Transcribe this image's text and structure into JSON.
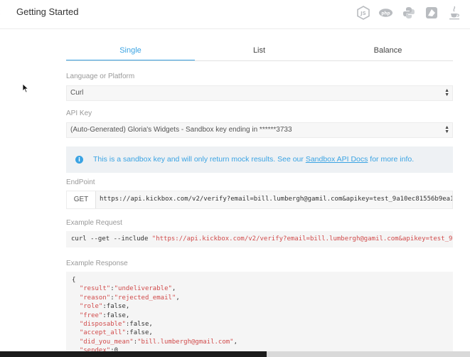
{
  "header": {
    "title": "Getting Started",
    "back_icon": "chevron-left-icon",
    "language_icons": [
      "nodejs-icon",
      "php-icon",
      "python-icon",
      "ruby-icon",
      "java-icon"
    ]
  },
  "tabs": [
    {
      "label": "Single",
      "active": true
    },
    {
      "label": "List",
      "active": false
    },
    {
      "label": "Balance",
      "active": false
    }
  ],
  "language": {
    "label": "Language or Platform",
    "value": "Curl"
  },
  "api_key": {
    "label": "API Key",
    "value": "(Auto-Generated) Gloria's Widgets - Sandbox key ending in ******3733"
  },
  "notice": {
    "text_before": "This is a sandbox key and will only return mock results. See our ",
    "link_text": "Sandbox API Docs",
    "text_after": " for more info."
  },
  "endpoint": {
    "label": "EndPoint",
    "method": "GET",
    "url": "https://api.kickbox.com/v2/verify?email=bill.lumbergh@gamil.com&apikey=test_9a10ec81556b9ea1"
  },
  "example_request": {
    "label": "Example Request",
    "command": "curl --get --include ",
    "url": "\"https://api.kickbox.com/v2/verify?email=bill.lumbergh@gamil.com&apikey=test_9"
  },
  "example_response": {
    "label": "Example Response",
    "open": "{",
    "lines": [
      {
        "key": "\"result\"",
        "val": "\"undeliverable\"",
        "str": true
      },
      {
        "key": "\"reason\"",
        "val": "\"rejected_email\"",
        "str": true
      },
      {
        "key": "\"role\"",
        "val": "false",
        "str": false
      },
      {
        "key": "\"free\"",
        "val": "false",
        "str": false
      },
      {
        "key": "\"disposable\"",
        "val": "false",
        "str": false
      },
      {
        "key": "\"accept_all\"",
        "val": "false",
        "str": false
      },
      {
        "key": "\"did_you_mean\"",
        "val": "\"bill.lumbergh@gmail.com\"",
        "str": true
      },
      {
        "key": "\"sendex\"",
        "val": "0",
        "str": false
      }
    ]
  },
  "colors": {
    "accent": "#3aa3e3",
    "string": "#d14b4b"
  }
}
